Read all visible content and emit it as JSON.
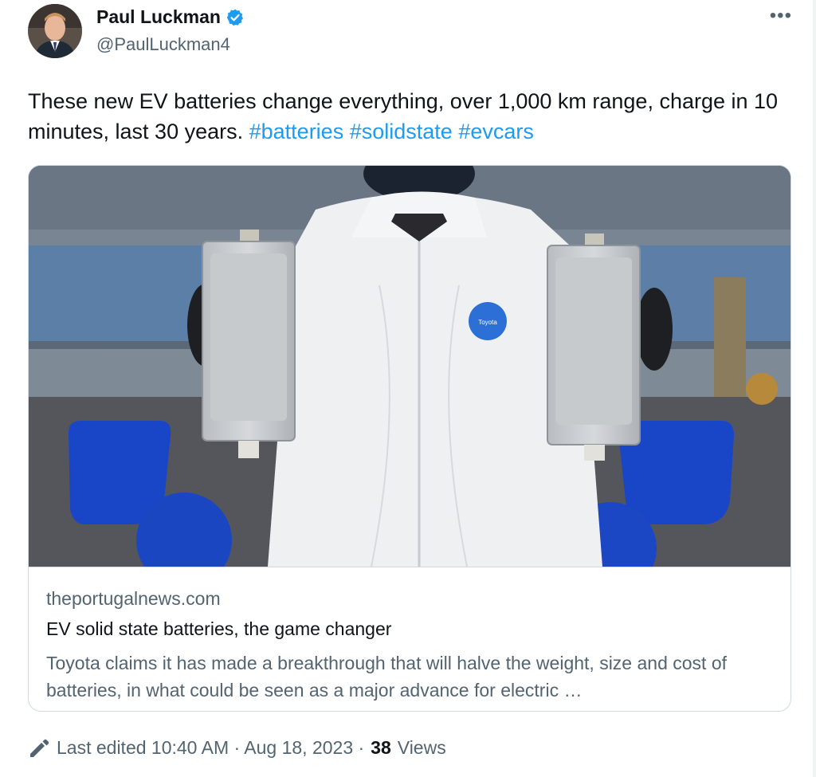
{
  "author": {
    "name": "Paul Luckman",
    "handle": "@PaulLuckman4"
  },
  "tweet": {
    "text": "These new EV batteries change everything, over 1,000 km range, charge in 10 minutes, last 30 years. ",
    "hashtags": [
      "#batteries",
      "#solidstate",
      "#evcars"
    ]
  },
  "card": {
    "domain": "theportugalnews.com",
    "title": "EV solid state batteries, the game changer",
    "description": "Toyota claims it has made a breakthrough that will halve the weight, size and cost of batteries, in what could be seen as a major advance for electric …",
    "image_logo_text": "Toyota"
  },
  "footer": {
    "edited_label": "Last edited 10:40 AM · Aug 18, 2023 ·",
    "views_count": "38",
    "views_label": "Views"
  },
  "icons": {
    "more": "more-icon",
    "verified": "verified-badge-icon",
    "edit": "pencil-icon"
  },
  "colors": {
    "link": "#1d9bf0",
    "secondary_text": "#536471",
    "verified": "#1d9bf0"
  }
}
